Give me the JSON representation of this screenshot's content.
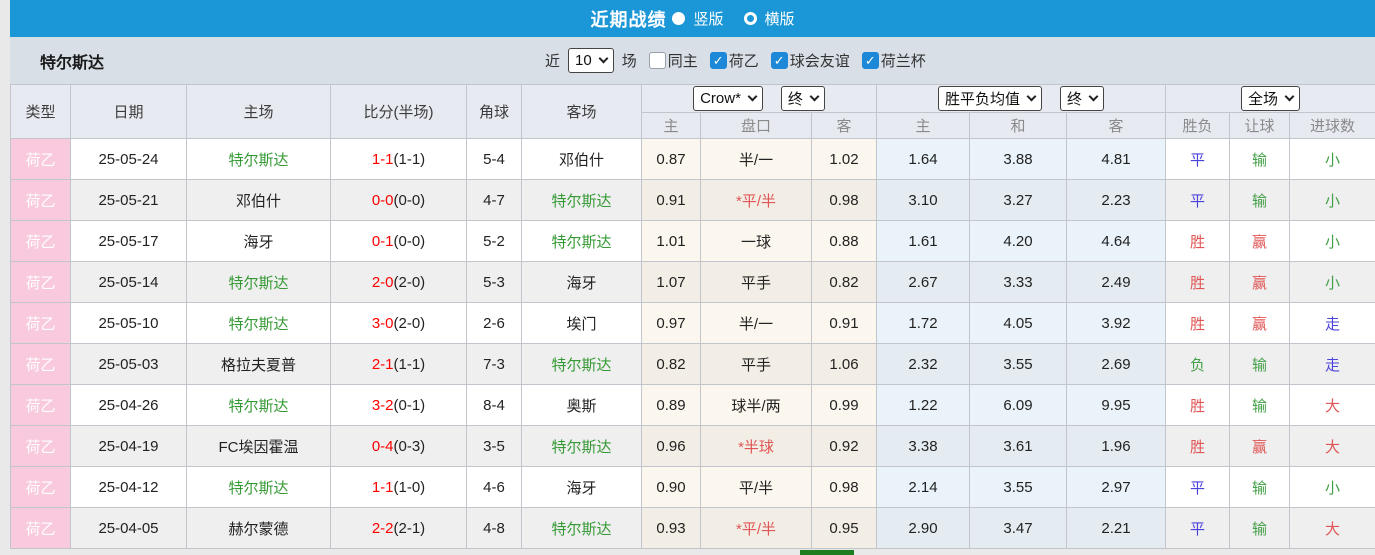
{
  "icons": {
    "check": "✓"
  },
  "header_bar": {
    "title": "近期战绩",
    "radio_options": [
      {
        "label": "竖版",
        "selected": true
      },
      {
        "label": "横版",
        "selected": false
      }
    ]
  },
  "toolbar": {
    "team_name": "特尔斯达",
    "near_label": "近",
    "count_value": "10",
    "games_label": "场",
    "filters": [
      {
        "label": "同主",
        "checked": false
      },
      {
        "label": "荷乙",
        "checked": true
      },
      {
        "label": "球会友谊",
        "checked": true
      },
      {
        "label": "荷兰杯",
        "checked": true
      }
    ]
  },
  "table": {
    "main_headers": [
      "类型",
      "日期",
      "主场",
      "比分(半场)",
      "角球",
      "客场"
    ],
    "group_selects": {
      "odds_company": "Crow*",
      "odds_time": "终",
      "avg_label": "胜平负均值",
      "avg_time": "终",
      "scope": "全场"
    },
    "sub_headers": {
      "odds_home": "主",
      "odds_handicap": "盘口",
      "odds_away": "客",
      "avg_home": "主",
      "avg_draw": "和",
      "avg_away": "客",
      "result": "胜负",
      "let_goal": "让球",
      "goals_count": "进球数"
    },
    "rows": [
      {
        "type": "荷乙",
        "date": "25-05-24",
        "home": "特尔斯达",
        "home_is_target": true,
        "score_ft": "1-1",
        "score_ht": "(1-1)",
        "corners": "5-4",
        "away": "邓伯什",
        "away_is_target": false,
        "odds_home": "0.87",
        "handicap": "半/一",
        "handicap_red": false,
        "odds_away": "1.02",
        "avg_home": "1.64",
        "avg_draw": "3.88",
        "avg_away": "4.81",
        "outcome": {
          "text": "平",
          "color": "blue"
        },
        "handicap_result": {
          "text": "输",
          "color": "green"
        },
        "goals": {
          "text": "小",
          "color": "green"
        }
      },
      {
        "type": "荷乙",
        "date": "25-05-21",
        "home": "邓伯什",
        "home_is_target": false,
        "score_ft": "0-0",
        "score_ht": "(0-0)",
        "corners": "4-7",
        "away": "特尔斯达",
        "away_is_target": true,
        "odds_home": "0.91",
        "handicap": "*平/半",
        "handicap_red": true,
        "odds_away": "0.98",
        "avg_home": "3.10",
        "avg_draw": "3.27",
        "avg_away": "2.23",
        "outcome": {
          "text": "平",
          "color": "blue"
        },
        "handicap_result": {
          "text": "输",
          "color": "green"
        },
        "goals": {
          "text": "小",
          "color": "green"
        }
      },
      {
        "type": "荷乙",
        "date": "25-05-17",
        "home": "海牙",
        "home_is_target": false,
        "score_ft": "0-1",
        "score_ht": "(0-0)",
        "corners": "5-2",
        "away": "特尔斯达",
        "away_is_target": true,
        "odds_home": "1.01",
        "handicap": "一球",
        "handicap_red": false,
        "odds_away": "0.88",
        "avg_home": "1.61",
        "avg_draw": "4.20",
        "avg_away": "4.64",
        "outcome": {
          "text": "胜",
          "color": "red"
        },
        "handicap_result": {
          "text": "赢",
          "color": "red"
        },
        "goals": {
          "text": "小",
          "color": "green"
        }
      },
      {
        "type": "荷乙",
        "date": "25-05-14",
        "home": "特尔斯达",
        "home_is_target": true,
        "score_ft": "2-0",
        "score_ht": "(2-0)",
        "corners": "5-3",
        "away": "海牙",
        "away_is_target": false,
        "odds_home": "1.07",
        "handicap": "平手",
        "handicap_red": false,
        "odds_away": "0.82",
        "avg_home": "2.67",
        "avg_draw": "3.33",
        "avg_away": "2.49",
        "outcome": {
          "text": "胜",
          "color": "red"
        },
        "handicap_result": {
          "text": "赢",
          "color": "red"
        },
        "goals": {
          "text": "小",
          "color": "green"
        }
      },
      {
        "type": "荷乙",
        "date": "25-05-10",
        "home": "特尔斯达",
        "home_is_target": true,
        "score_ft": "3-0",
        "score_ht": "(2-0)",
        "corners": "2-6",
        "away": "埃门",
        "away_is_target": false,
        "odds_home": "0.97",
        "handicap": "半/一",
        "handicap_red": false,
        "odds_away": "0.91",
        "avg_home": "1.72",
        "avg_draw": "4.05",
        "avg_away": "3.92",
        "outcome": {
          "text": "胜",
          "color": "red"
        },
        "handicap_result": {
          "text": "赢",
          "color": "red"
        },
        "goals": {
          "text": "走",
          "color": "blue"
        }
      },
      {
        "type": "荷乙",
        "date": "25-05-03",
        "home": "格拉夫夏普",
        "home_is_target": false,
        "score_ft": "2-1",
        "score_ht": "(1-1)",
        "corners": "7-3",
        "away": "特尔斯达",
        "away_is_target": true,
        "odds_home": "0.82",
        "handicap": "平手",
        "handicap_red": false,
        "odds_away": "1.06",
        "avg_home": "2.32",
        "avg_draw": "3.55",
        "avg_away": "2.69",
        "outcome": {
          "text": "负",
          "color": "green"
        },
        "handicap_result": {
          "text": "输",
          "color": "green"
        },
        "goals": {
          "text": "走",
          "color": "blue"
        }
      },
      {
        "type": "荷乙",
        "date": "25-04-26",
        "home": "特尔斯达",
        "home_is_target": true,
        "score_ft": "3-2",
        "score_ht": "(0-1)",
        "corners": "8-4",
        "away": "奥斯",
        "away_is_target": false,
        "odds_home": "0.89",
        "handicap": "球半/两",
        "handicap_red": false,
        "odds_away": "0.99",
        "avg_home": "1.22",
        "avg_draw": "6.09",
        "avg_away": "9.95",
        "outcome": {
          "text": "胜",
          "color": "red"
        },
        "handicap_result": {
          "text": "输",
          "color": "green"
        },
        "goals": {
          "text": "大",
          "color": "red"
        }
      },
      {
        "type": "荷乙",
        "date": "25-04-19",
        "home": "FC埃因霍温",
        "home_is_target": false,
        "score_ft": "0-4",
        "score_ht": "(0-3)",
        "corners": "3-5",
        "away": "特尔斯达",
        "away_is_target": true,
        "odds_home": "0.96",
        "handicap": "*半球",
        "handicap_red": true,
        "odds_away": "0.92",
        "avg_home": "3.38",
        "avg_draw": "3.61",
        "avg_away": "1.96",
        "outcome": {
          "text": "胜",
          "color": "red"
        },
        "handicap_result": {
          "text": "赢",
          "color": "red"
        },
        "goals": {
          "text": "大",
          "color": "red"
        }
      },
      {
        "type": "荷乙",
        "date": "25-04-12",
        "home": "特尔斯达",
        "home_is_target": true,
        "score_ft": "1-1",
        "score_ht": "(1-0)",
        "corners": "4-6",
        "away": "海牙",
        "away_is_target": false,
        "odds_home": "0.90",
        "handicap": "平/半",
        "handicap_red": false,
        "odds_away": "0.98",
        "avg_home": "2.14",
        "avg_draw": "3.55",
        "avg_away": "2.97",
        "outcome": {
          "text": "平",
          "color": "blue"
        },
        "handicap_result": {
          "text": "输",
          "color": "green"
        },
        "goals": {
          "text": "小",
          "color": "green"
        }
      },
      {
        "type": "荷乙",
        "date": "25-04-05",
        "home": "赫尔蒙德",
        "home_is_target": false,
        "score_ft": "2-2",
        "score_ht": "(2-1)",
        "corners": "4-8",
        "away": "特尔斯达",
        "away_is_target": true,
        "odds_home": "0.93",
        "handicap": "*平/半",
        "handicap_red": true,
        "odds_away": "0.95",
        "avg_home": "2.90",
        "avg_draw": "3.47",
        "avg_away": "2.21",
        "outcome": {
          "text": "平",
          "color": "blue"
        },
        "handicap_result": {
          "text": "输",
          "color": "green"
        },
        "goals": {
          "text": "大",
          "color": "red"
        }
      }
    ]
  },
  "colors": {
    "accent_blue": "#1b96d6",
    "type_pink": "#f9c9dd",
    "score_red": "#ff0000",
    "team_green": "#359a35",
    "win_red": "#e05555",
    "draw_blue": "#4a43dd",
    "lose_green": "#44a048",
    "bottom_green": "#1e7d1e"
  }
}
